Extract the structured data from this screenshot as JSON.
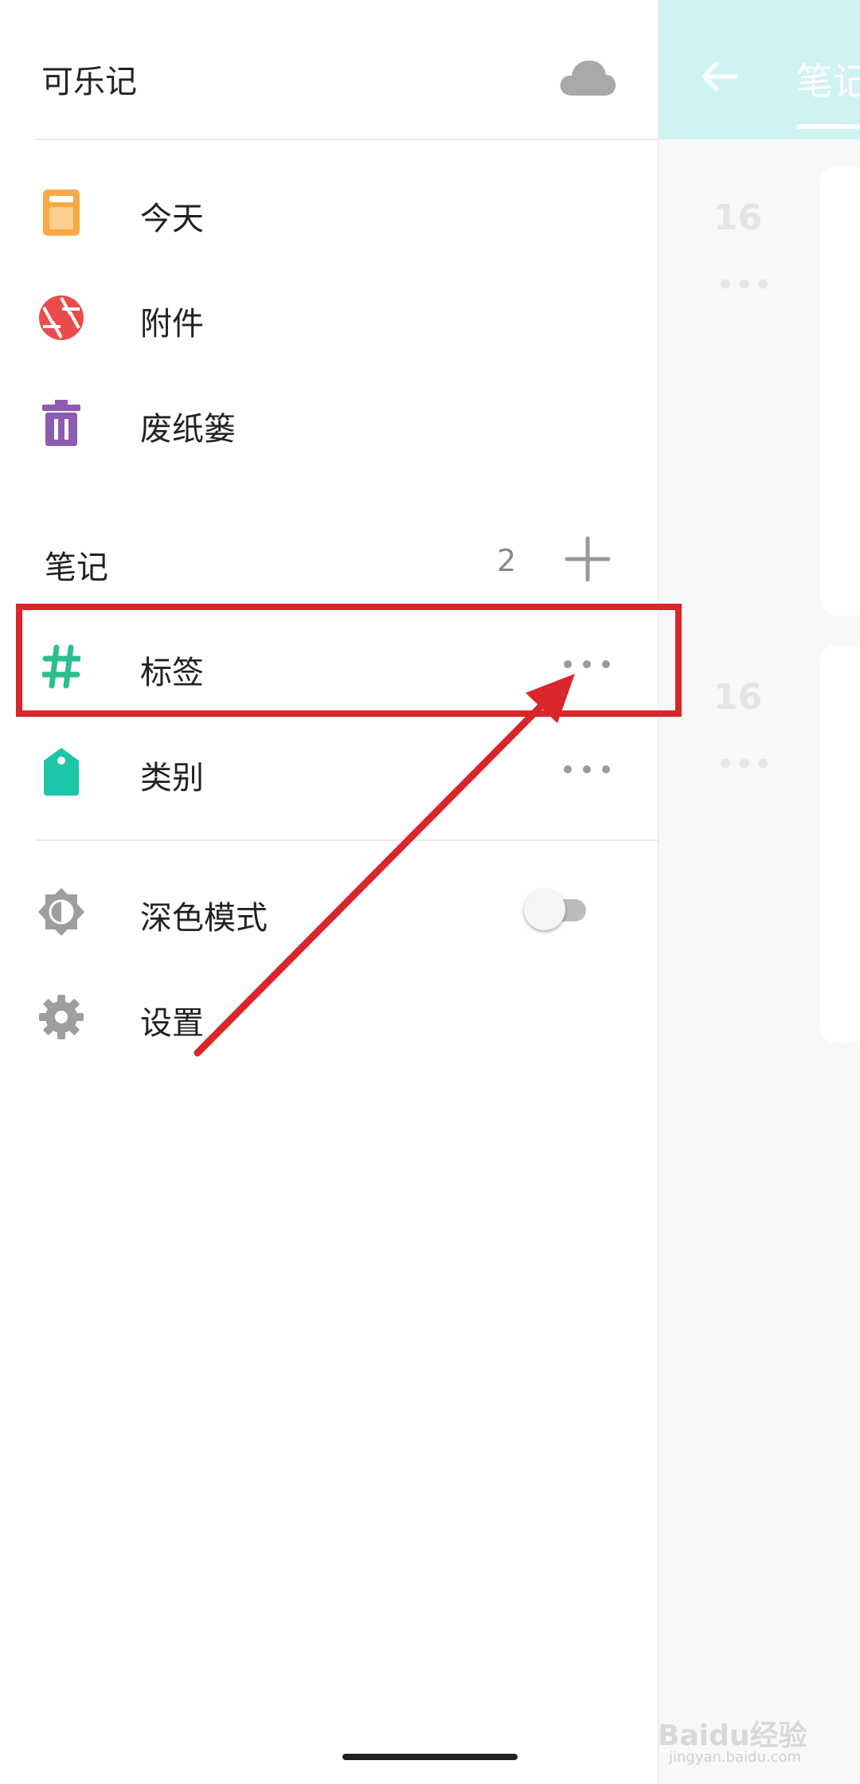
{
  "app": {
    "title": "可乐记"
  },
  "background": {
    "header_title": "笔记",
    "cards": [
      {
        "day": "16",
        "more": "•••"
      },
      {
        "day": "16",
        "more": "•••"
      }
    ]
  },
  "drawer": {
    "items": [
      {
        "label": "今天",
        "icon": "today-icon",
        "color": "#f7a942"
      },
      {
        "label": "附件",
        "icon": "attachment-aperture-icon",
        "color": "#ea4b4b"
      },
      {
        "label": "废纸篓",
        "icon": "trash-icon",
        "color": "#8d5bb0"
      }
    ],
    "notes_section": {
      "title": "笔记",
      "count": "2",
      "items": [
        {
          "label": "标签",
          "icon": "hashtag-icon",
          "color": "#2bbf8f"
        },
        {
          "label": "类别",
          "icon": "tag-icon",
          "color": "#1cc7a9"
        }
      ]
    },
    "settings": [
      {
        "label": "深色模式",
        "icon": "dark-mode-icon",
        "toggle": false
      },
      {
        "label": "设置",
        "icon": "gear-icon"
      }
    ]
  },
  "annotation": {
    "color": "#d9262b"
  },
  "watermark": {
    "brand": "Baidu经验",
    "url": "jingyan.baidu.com"
  }
}
